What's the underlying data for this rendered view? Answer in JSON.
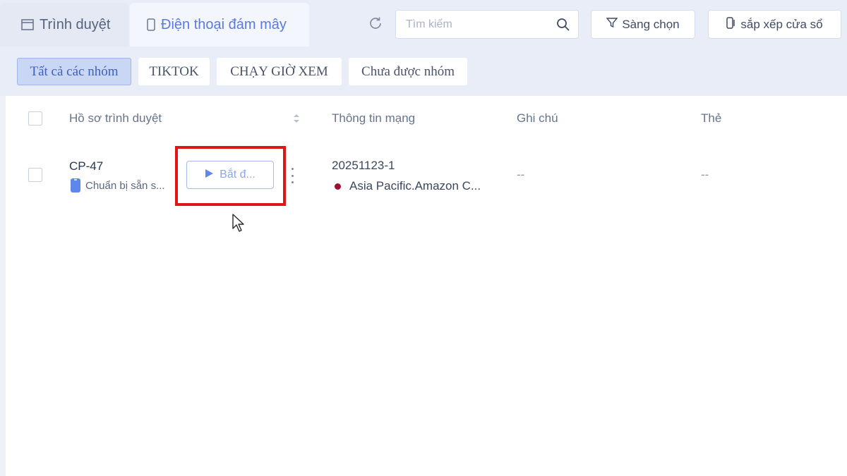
{
  "tabs": {
    "browser_label": "Trình duyệt",
    "cloud_phone_label": "Điện thoại đám mây"
  },
  "search": {
    "placeholder": "Tìm kiếm"
  },
  "toolbar": {
    "filter_label": "Sàng chọn",
    "sort_windows_label": "sắp xếp cửa sổ"
  },
  "groups": [
    "Tất cả các nhóm",
    "TIKTOK",
    "CHẠY GIỜ XEM",
    "Chưa được nhóm"
  ],
  "table": {
    "headers": {
      "profile": "Hồ sơ trình duyệt",
      "network": "Thông tin mạng",
      "note": "Ghi chú",
      "tag": "Thẻ"
    },
    "rows": [
      {
        "name": "CP-47",
        "status": "Chuẩn bị sẵn s...",
        "start_label": "Bắt đ...",
        "network_id": "20251123-1",
        "network_location": "Asia Pacific.Amazon C...",
        "note": "--",
        "tag": "--"
      }
    ]
  },
  "colors": {
    "accent": "#5a7ae0",
    "highlight_box": "#e01515",
    "location_dot": "#9b1035"
  },
  "icons": [
    "browser-window-icon",
    "phone-icon",
    "refresh-icon",
    "search-icon",
    "filter-icon",
    "window-icon",
    "sort-icon",
    "play-icon",
    "more-vertical-icon",
    "cursor-pointer-icon"
  ]
}
